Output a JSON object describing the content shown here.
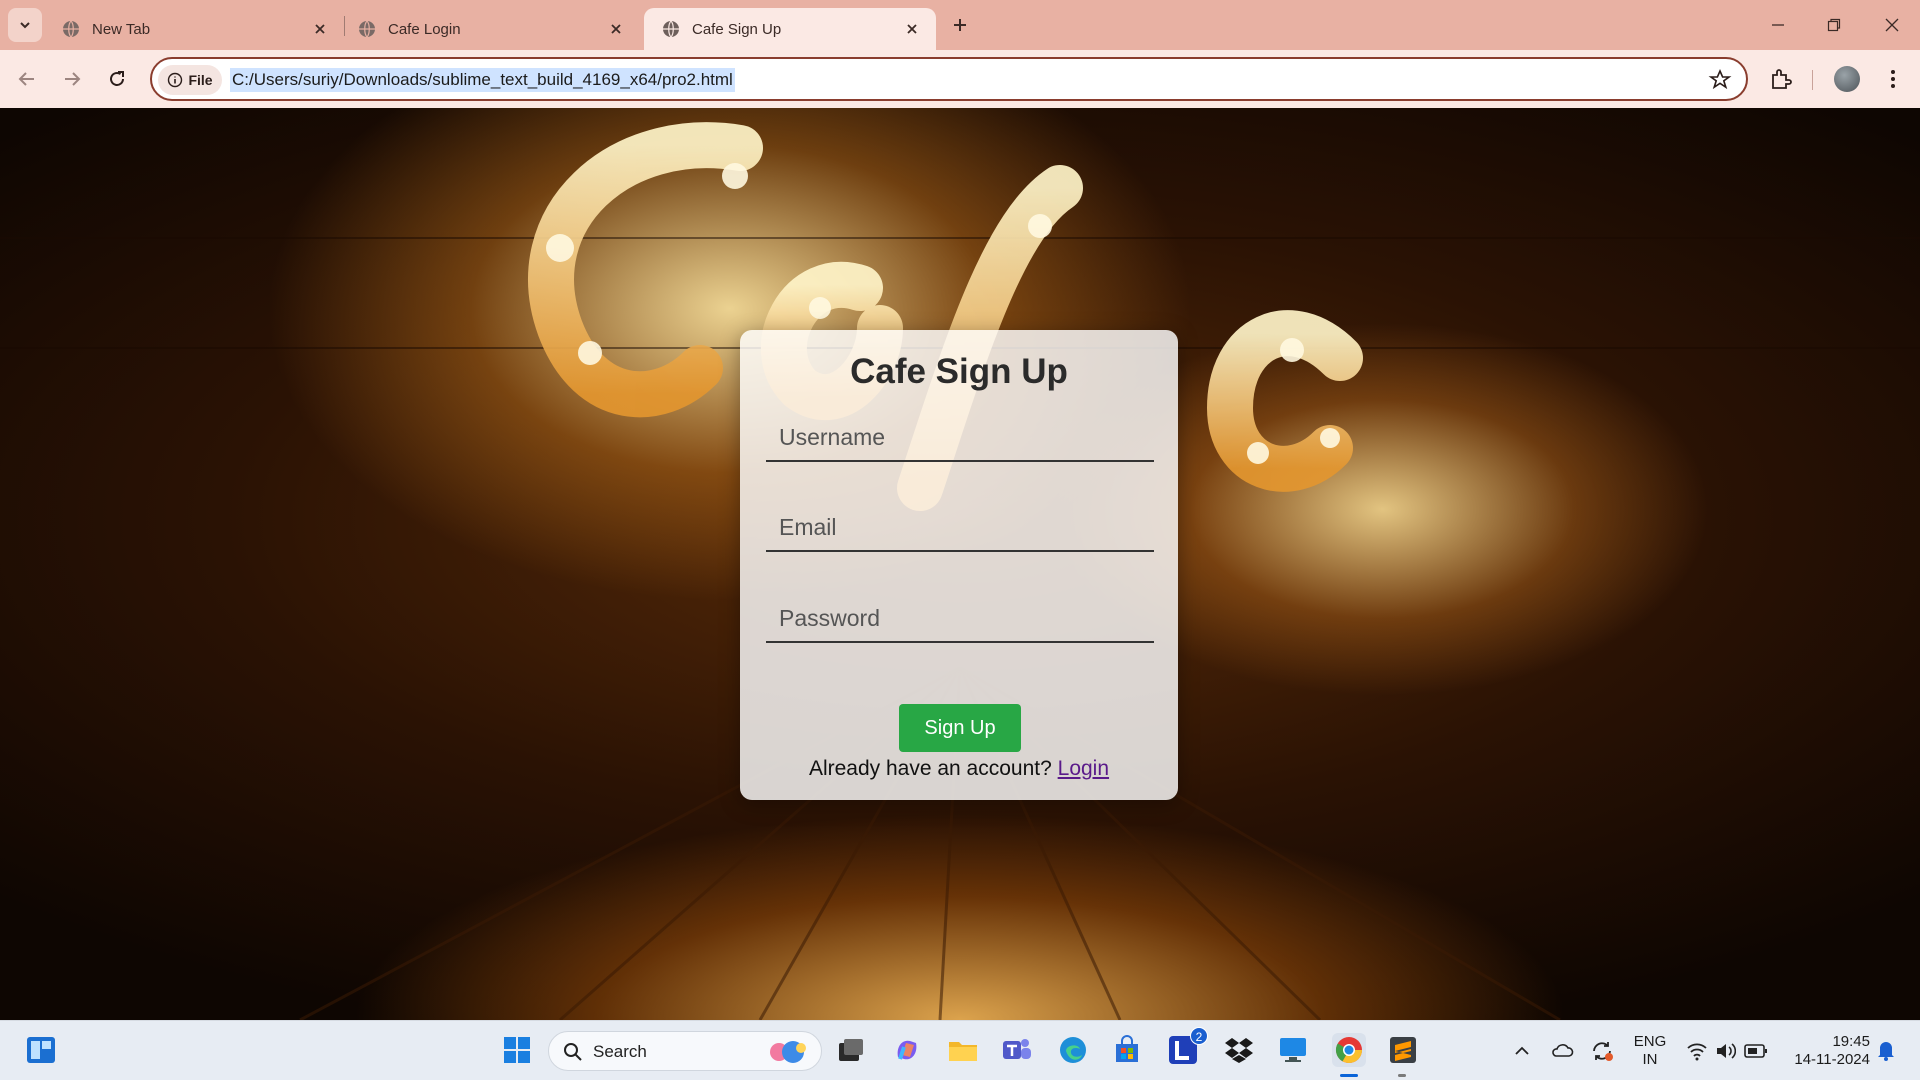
{
  "browser": {
    "tabs": [
      {
        "title": "New Tab",
        "active": false
      },
      {
        "title": "Cafe Login",
        "active": false
      },
      {
        "title": "Cafe Sign Up",
        "active": true
      }
    ],
    "site_chip": "File",
    "url": "C:/Users/suriy/Downloads/sublime_text_build_4169_x64/pro2.html"
  },
  "page": {
    "title": "Cafe Sign Up",
    "username_placeholder": "Username",
    "email_placeholder": "Email",
    "password_placeholder": "Password",
    "signup_button": "Sign Up",
    "account_prompt": "Already have an account?",
    "login_link": "Login",
    "colors": {
      "button": "#28a745",
      "link": "#5a1a8a"
    }
  },
  "taskbar": {
    "search_label": "Search",
    "lang_line1": "ENG",
    "lang_line2": "IN",
    "time": "19:45",
    "date": "14-11-2024",
    "l_badge": "2"
  }
}
